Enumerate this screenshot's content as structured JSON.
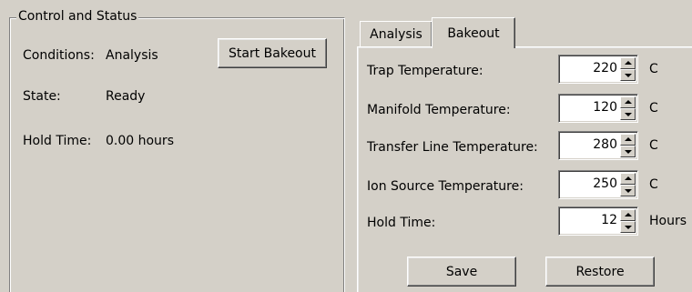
{
  "control_status": {
    "title": "Control and Status",
    "conditions_label": "Conditions:",
    "conditions_value": "Analysis",
    "state_label": "State:",
    "state_value": "Ready",
    "hold_time_label": "Hold Time:",
    "hold_time_value": "0.00 hours",
    "start_bakeout_label": "Start Bakeout"
  },
  "tabs": [
    {
      "label": "Analysis",
      "active": false
    },
    {
      "label": "Bakeout",
      "active": true
    }
  ],
  "bakeout": {
    "fields": [
      {
        "label": "Trap Temperature:",
        "value": "220",
        "unit": "C"
      },
      {
        "label": "Manifold Temperature:",
        "value": "120",
        "unit": "C"
      },
      {
        "label": "Transfer Line Temperature:",
        "value": "280",
        "unit": "C"
      },
      {
        "label": "Ion Source Temperature:",
        "value": "250",
        "unit": "C"
      },
      {
        "label": "Hold Time:",
        "value": "12",
        "unit": "Hours"
      }
    ],
    "save_label": "Save",
    "restore_label": "Restore"
  }
}
